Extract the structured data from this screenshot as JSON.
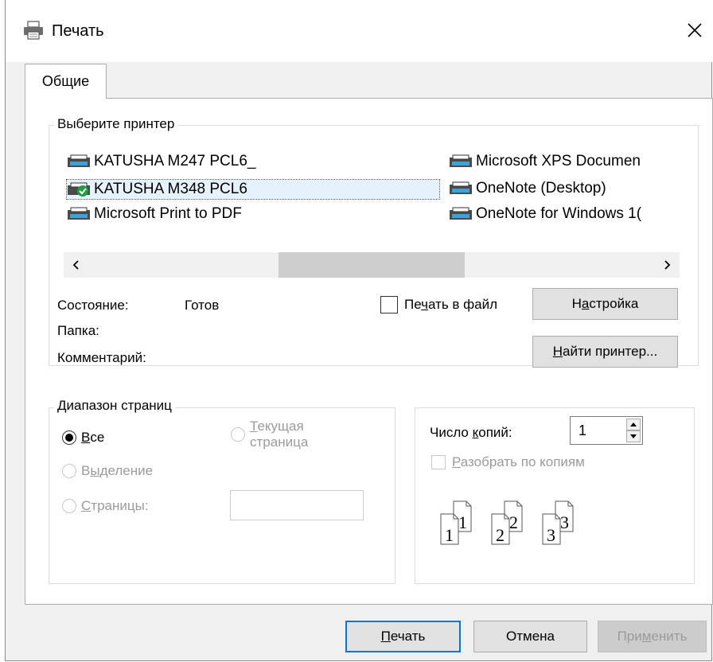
{
  "window": {
    "title": "Печать"
  },
  "tabs": [
    {
      "label": "Общие"
    }
  ],
  "printer_group": {
    "label": "Выберите принтер",
    "printers": [
      {
        "name": "KATUSHA M247 PCL6_"
      },
      {
        "name": "KATUSHA M348 PCL6",
        "selected": true,
        "default": true
      },
      {
        "name": "Microsoft Print to PDF"
      },
      {
        "name": "Microsoft XPS Documen"
      },
      {
        "name": "OneNote (Desktop)"
      },
      {
        "name": "OneNote for Windows 1("
      }
    ],
    "status_label": "Состояние:",
    "status_value": "Готов",
    "folder_label": "Папка:",
    "comment_label": "Комментарий:",
    "print_to_file_pre": "Пе",
    "print_to_file_accel": "ч",
    "print_to_file_post": "ать в файл",
    "setup_pre": "Н",
    "setup_accel": "а",
    "setup_post": "стройка",
    "find_pre": "",
    "find_accel": "Н",
    "find_post": "айти принтер..."
  },
  "page_range": {
    "label": "Диапазон страниц",
    "all_accel": "В",
    "all_post": "се",
    "selection_pre": "В",
    "selection_accel": "ы",
    "selection_post": "деление",
    "current_accel": "Т",
    "current_post": "екущая",
    "current_line2": "страница",
    "pages_accel": "С",
    "pages_post": "траницы:",
    "selected": "all"
  },
  "copies": {
    "label_pre": "Число ",
    "label_accel": "к",
    "label_post": "опий:",
    "value": "1",
    "collate_accel": "Р",
    "collate_post": "азобрать по копиям",
    "collate_checked": false,
    "collate_pages": [
      "1",
      "1",
      "2",
      "2",
      "3",
      "3"
    ]
  },
  "buttons": {
    "print_accel": "П",
    "print_post": "ечать",
    "cancel": "Отмена",
    "apply_pre": "При",
    "apply_accel": "м",
    "apply_post": "енить"
  },
  "colors": {
    "accent": "#0078d7",
    "window_bg": "#f0f0f0",
    "selection_bg": "#e5f1fb",
    "ok_green": "#1e9e3e"
  }
}
